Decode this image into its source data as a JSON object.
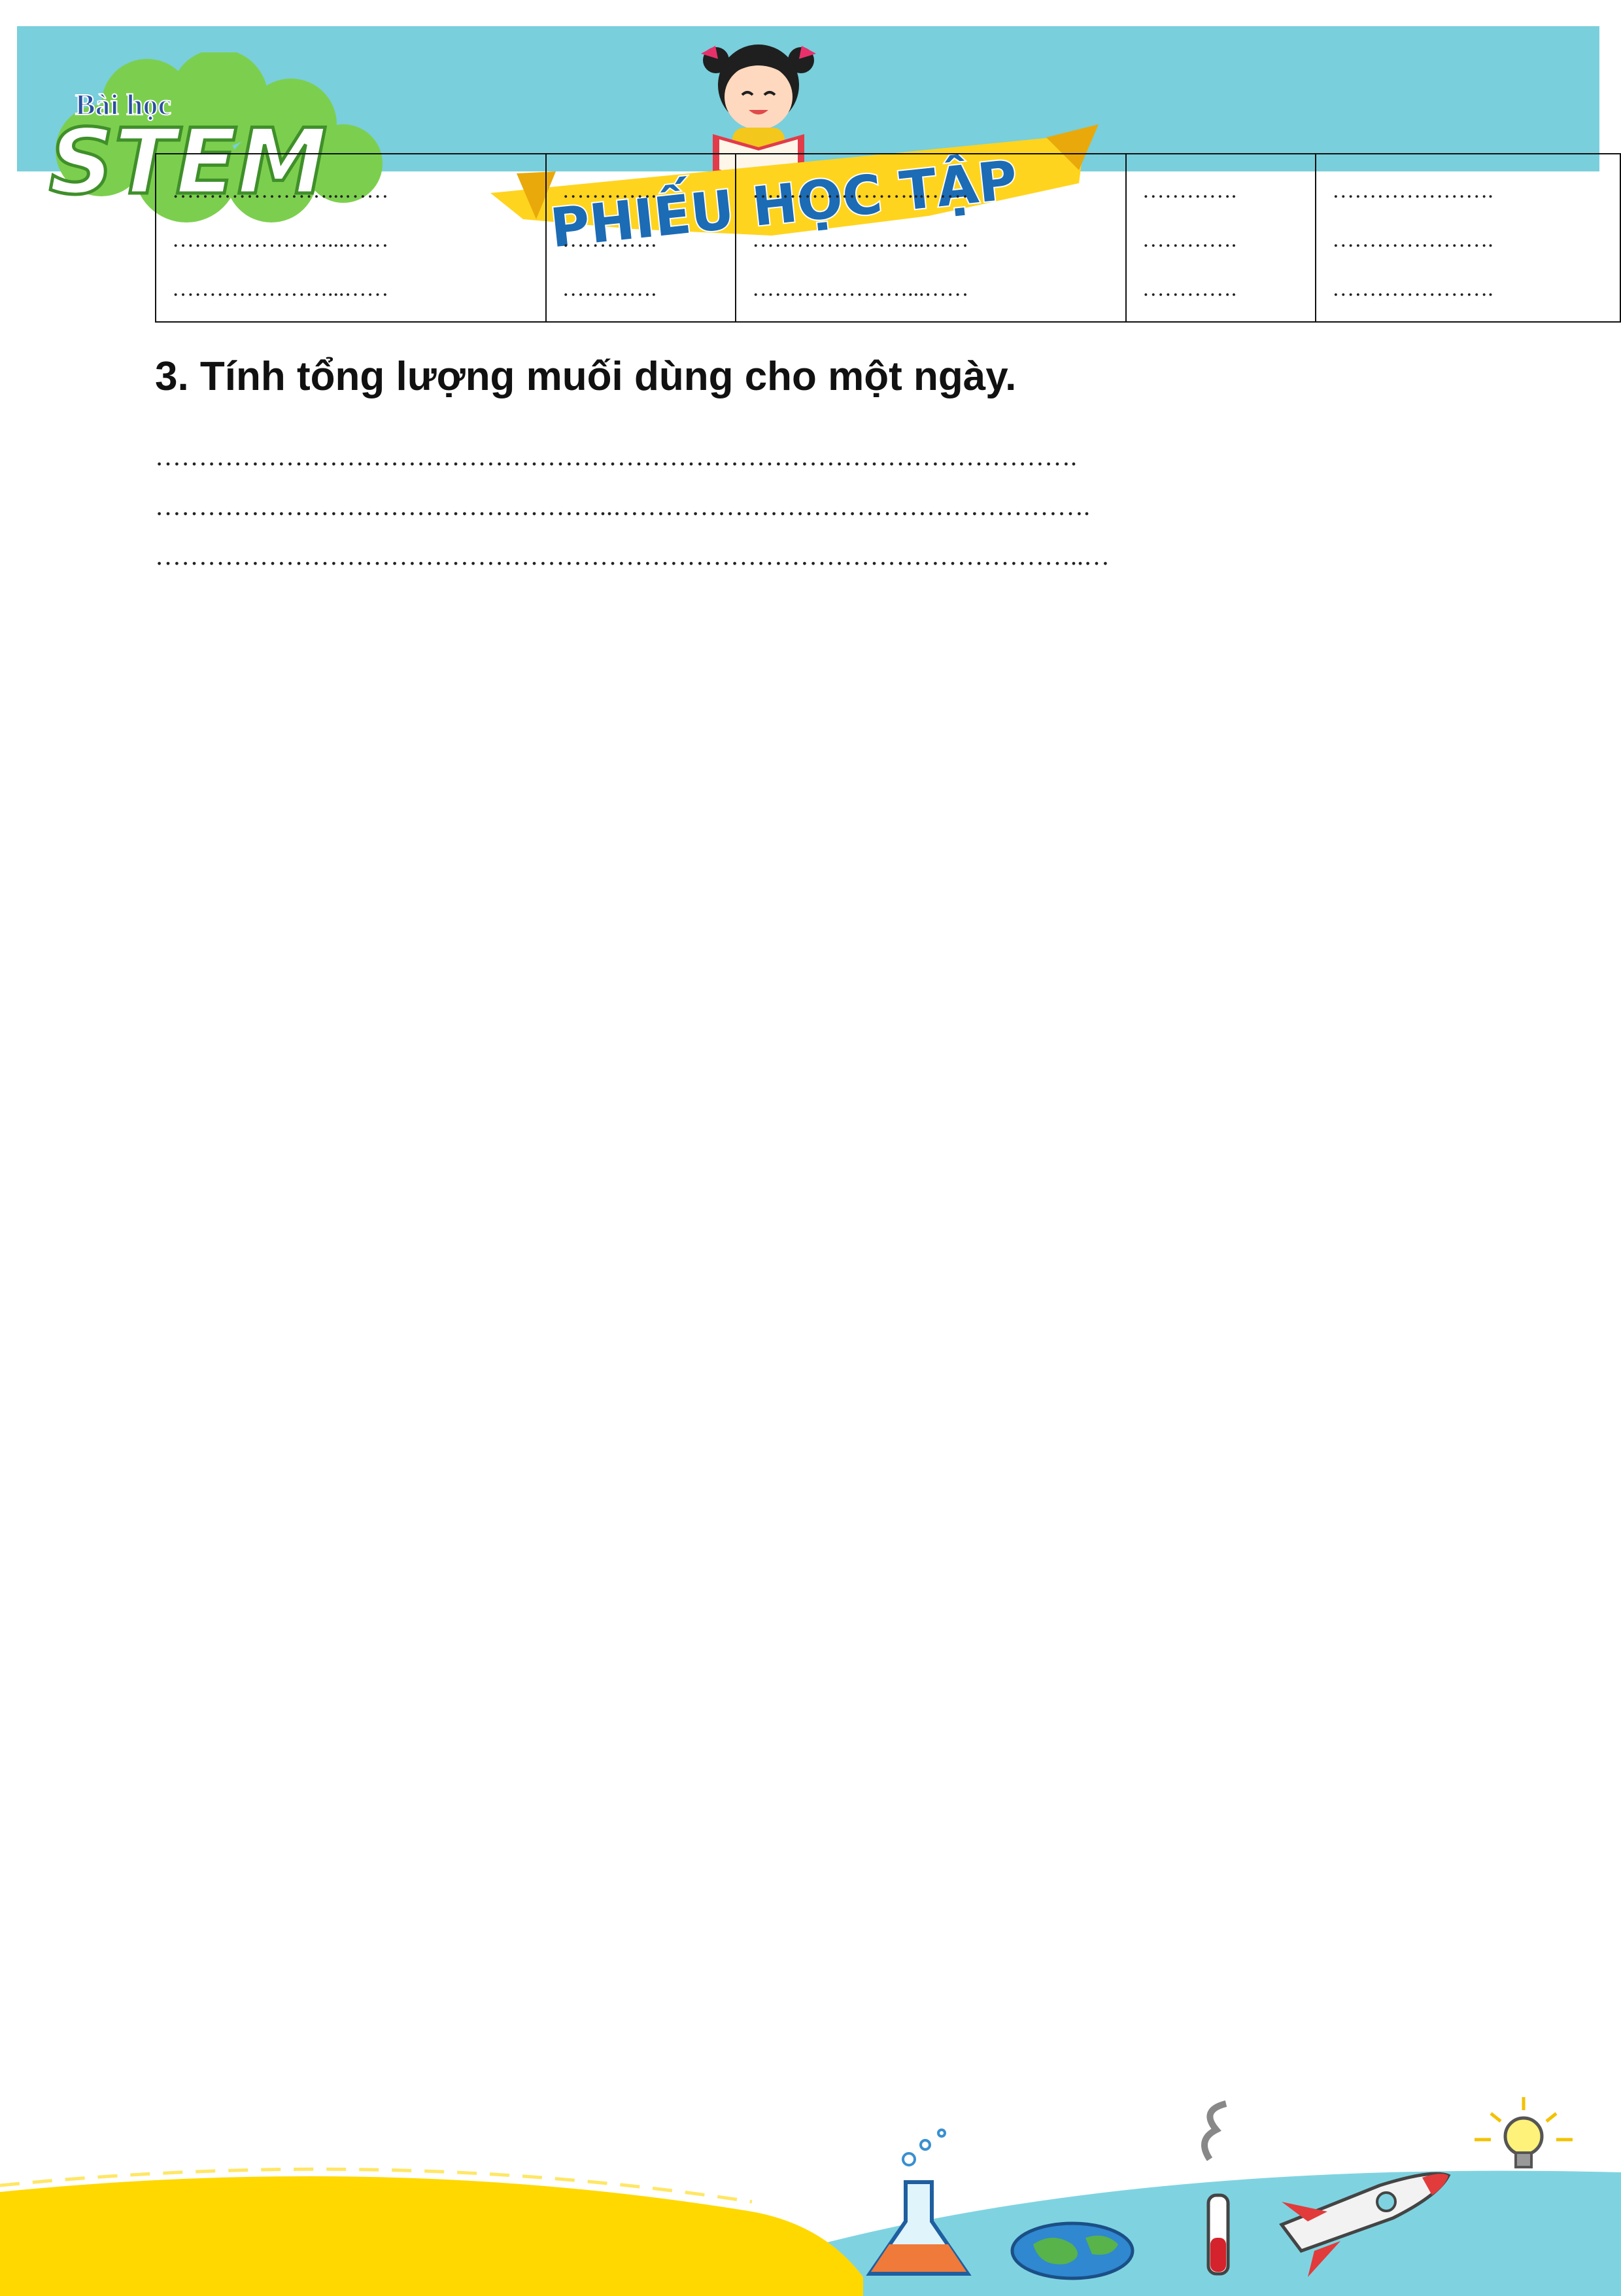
{
  "header": {
    "brand_small": "Bài học",
    "brand_big": "STEM",
    "banner_text": "PHIẾU HỌC TẬP"
  },
  "table": {
    "rows": [
      [
        "…………………...……",
        "………….",
        "…………………...……",
        "………….",
        "…………………."
      ],
      [
        "…………………...……",
        "………….",
        "…………………...……",
        "………….",
        "…………………."
      ],
      [
        "…………………...……",
        "………….",
        "…………………...……",
        "………….",
        "…………………."
      ]
    ]
  },
  "question": {
    "text": "3. Tính tổng lượng muối dùng cho một ngày."
  },
  "answer_lines": [
    "…………………………………………………………………………………………….",
    "……………………………………………..……………………………………………….",
    "……………………………………………………………………………………………..…"
  ],
  "colors": {
    "header_band": "#79cfdc",
    "logo_green": "#7ccf4e",
    "banner_yellow": "#ffd41e",
    "banner_text": "#1c6bb5",
    "footer_yellow": "#ffd800",
    "footer_blue": "#7fd3e1"
  },
  "icons": [
    "cloud-logo-icon",
    "girl-reading-icon",
    "flask-icon",
    "globe-icon",
    "test-tube-icon",
    "rocket-icon",
    "lightbulb-icon"
  ]
}
